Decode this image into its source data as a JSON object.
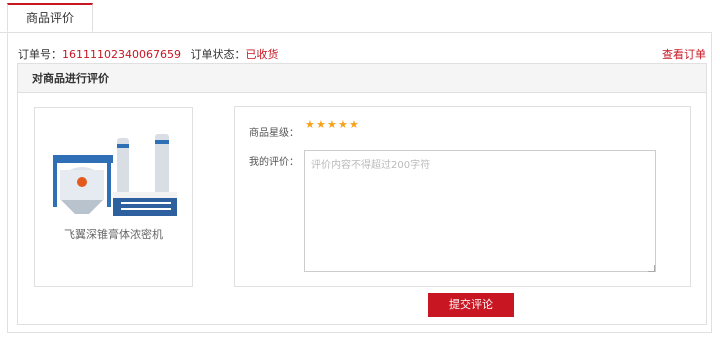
{
  "tab": {
    "label": "商品评价"
  },
  "order": {
    "number_label": "订单号：",
    "number_value": "16111102340067659",
    "status_label": "订单状态：",
    "status_value": "已收货",
    "view_order_link": "查看订单"
  },
  "review_section": {
    "title": "对商品进行评价"
  },
  "product": {
    "name": "飞翼深锥膏体浓密机"
  },
  "form": {
    "rating_label": "商品星级：",
    "rating_value": 5,
    "rating_max": 5,
    "comment_label": "我的评价：",
    "comment_placeholder": "评价内容不得超过200字符",
    "comment_value": "",
    "submit_label": "提交评论"
  },
  "colors": {
    "accent": "#c81623",
    "star": "#f7a21b",
    "border": "#e0e0e0"
  }
}
